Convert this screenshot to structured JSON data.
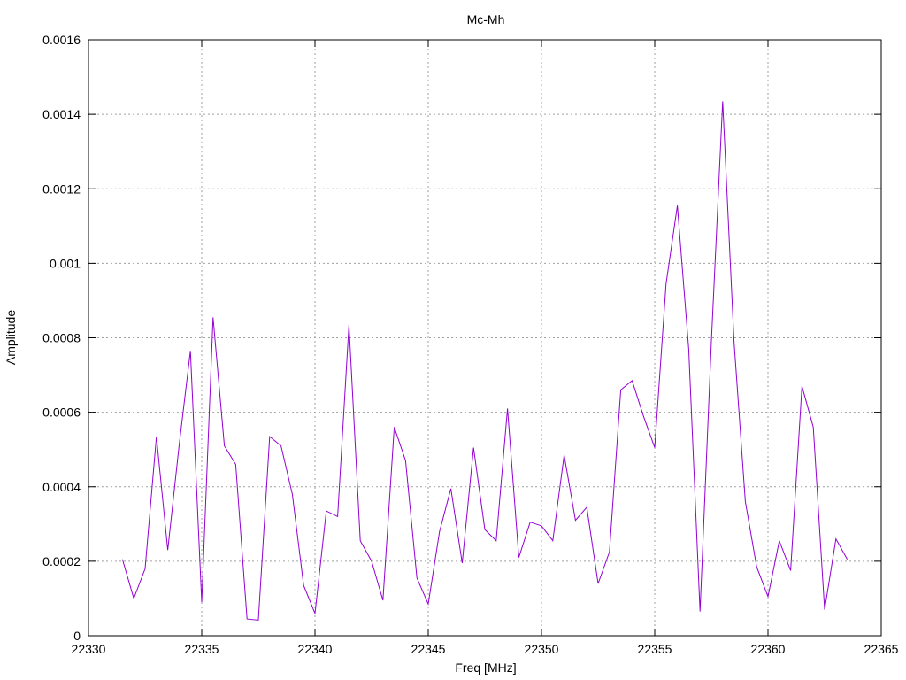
{
  "chart_data": {
    "type": "line",
    "title": "Mc-Mh",
    "xlabel": "Freq [MHz]",
    "ylabel": "Amplitude",
    "xlim": [
      22330,
      22365
    ],
    "ylim": [
      0,
      0.0016
    ],
    "xticks": [
      22330,
      22335,
      22340,
      22345,
      22350,
      22355,
      22360,
      22365
    ],
    "xtick_labels": [
      "22330",
      "22335",
      "22340",
      "22345",
      "22350",
      "22355",
      "22360",
      "22365"
    ],
    "yticks": [
      0,
      0.0002,
      0.0004,
      0.0006,
      0.0008,
      0.001,
      0.0012,
      0.0014,
      0.0016
    ],
    "ytick_labels": [
      "0",
      "0.0002",
      "0.0004",
      "0.0006",
      "0.0008",
      "0.001",
      "0.0012",
      "0.0014",
      "0.0016"
    ],
    "grid": true,
    "series": [
      {
        "color": "#9400d3",
        "x": [
          22331.5,
          22332.0,
          22332.5,
          22333.0,
          22333.5,
          22334.0,
          22334.5,
          22335.0,
          22335.5,
          22336.0,
          22336.5,
          22337.0,
          22337.5,
          22338.0,
          22338.5,
          22339.0,
          22339.5,
          22340.0,
          22340.5,
          22341.0,
          22341.5,
          22342.0,
          22342.5,
          22343.0,
          22343.5,
          22344.0,
          22344.5,
          22345.0,
          22345.5,
          22346.0,
          22346.5,
          22347.0,
          22347.5,
          22348.0,
          22348.5,
          22349.0,
          22349.5,
          22350.0,
          22350.5,
          22351.0,
          22351.5,
          22352.0,
          22352.5,
          22353.0,
          22353.5,
          22354.0,
          22354.5,
          22355.0,
          22355.5,
          22356.0,
          22356.5,
          22357.0,
          22357.5,
          22358.0,
          22358.5,
          22359.0,
          22359.5,
          22360.0,
          22360.5,
          22361.0,
          22361.5,
          22362.0,
          22362.5,
          22363.0,
          22363.5
        ],
        "y": [
          0.000205,
          0.0001,
          0.00018,
          0.000535,
          0.00023,
          0.00051,
          0.000765,
          9e-05,
          0.000855,
          0.00051,
          0.00046,
          4.5e-05,
          4.2e-05,
          0.000535,
          0.00051,
          0.00038,
          0.000135,
          6e-05,
          0.000335,
          0.00032,
          0.000835,
          0.000255,
          0.0002,
          9.5e-05,
          0.00056,
          0.00047,
          0.000155,
          8.5e-05,
          0.00028,
          0.000395,
          0.000195,
          0.000505,
          0.000285,
          0.000255,
          0.00061,
          0.00021,
          0.000305,
          0.000295,
          0.000255,
          0.000485,
          0.00031,
          0.000345,
          0.00014,
          0.000225,
          0.00066,
          0.000685,
          0.00059,
          0.000505,
          0.000945,
          0.001155,
          0.00077,
          6.5e-05,
          0.00079,
          0.001435,
          0.00079,
          0.00036,
          0.000185,
          0.000105,
          0.000255,
          0.000175,
          0.00067,
          0.00056,
          7e-05,
          0.00026,
          0.000205
        ]
      }
    ]
  }
}
